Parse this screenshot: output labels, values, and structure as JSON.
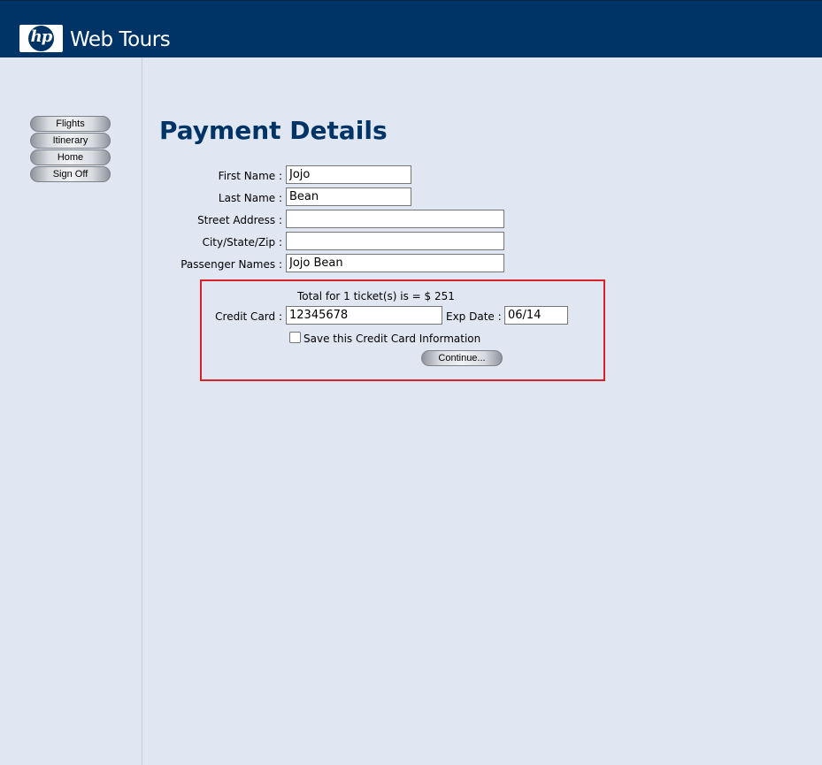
{
  "header": {
    "logo_text": "hp",
    "brand": "Web Tours"
  },
  "sidebar": {
    "items": [
      {
        "label": "Flights"
      },
      {
        "label": "Itinerary"
      },
      {
        "label": "Home"
      },
      {
        "label": "Sign Off"
      }
    ]
  },
  "main": {
    "title": "Payment Details",
    "form": {
      "first_name": {
        "label": "First Name :",
        "value": "Jojo"
      },
      "last_name": {
        "label": "Last Name :",
        "value": "Bean"
      },
      "street_address": {
        "label": "Street Address :",
        "value": ""
      },
      "city_state_zip": {
        "label": "City/State/Zip :",
        "value": ""
      },
      "passenger_names": {
        "label": "Passenger Names :",
        "value": "Jojo Bean"
      }
    },
    "payment": {
      "total_text": "Total for 1 ticket(s) is = $ 251",
      "credit_card_label": "Credit Card :",
      "credit_card_value": "12345678",
      "exp_date_label": "Exp Date :",
      "exp_date_value": "06/14",
      "save_card_label": "Save this Credit Card Information",
      "save_card_checked": false,
      "continue_label": "Continue..."
    }
  },
  "colors": {
    "header_bg": "#003466",
    "page_bg": "#e0e6f2",
    "title": "#003466",
    "highlight_border": "#d8222a"
  }
}
